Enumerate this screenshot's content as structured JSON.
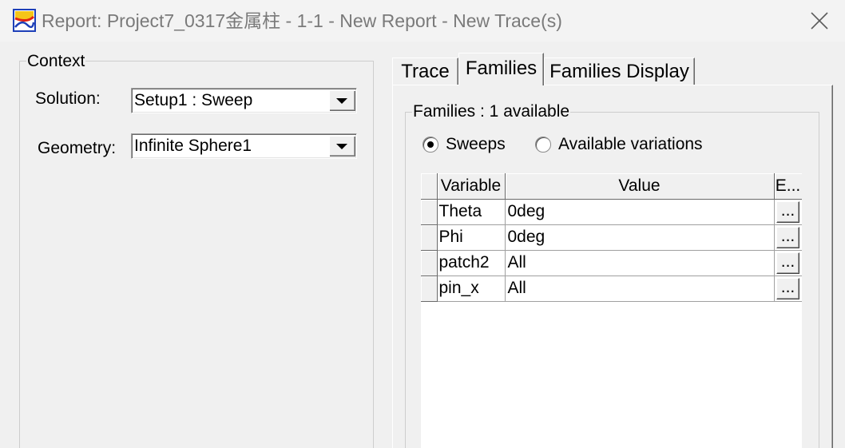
{
  "theme": {
    "window_bg": "#f0f0f0",
    "titlebar_bg": "#f3f3f3",
    "title_text_color": "#7a7a7a",
    "field_bg": "#ffffff",
    "grid_line": "#a0a0a0"
  },
  "window": {
    "title": "Report: Project7_0317金属柱 - 1-1 - New Report - New Trace(s)",
    "icon": "report-app-icon",
    "close_icon": "close-icon"
  },
  "context": {
    "group_label": "Context",
    "solution": {
      "label": "Solution:",
      "value": "Setup1 : Sweep",
      "dropdown_icon": "dropdown-arrow-icon"
    },
    "geometry": {
      "label": "Geometry:",
      "value": "Infinite Sphere1",
      "dropdown_icon": "dropdown-arrow-icon"
    }
  },
  "tabs": [
    {
      "label": "Trace",
      "active": false
    },
    {
      "label": "Families",
      "active": true
    },
    {
      "label": "Families Display",
      "active": false
    }
  ],
  "families": {
    "group_label": "Families : 1 available",
    "radios": [
      {
        "label": "Sweeps",
        "checked": true
      },
      {
        "label": "Available variations",
        "checked": false
      }
    ],
    "table": {
      "headers": {
        "variable": "Variable",
        "value": "Value",
        "edit": "E..."
      },
      "rows": [
        {
          "variable": "Theta",
          "value": "0deg",
          "edit_button": "..."
        },
        {
          "variable": "Phi",
          "value": "0deg",
          "edit_button": "..."
        },
        {
          "variable": "patch2",
          "value": "All",
          "edit_button": "..."
        },
        {
          "variable": "pin_x",
          "value": "All",
          "edit_button": "..."
        }
      ]
    }
  }
}
